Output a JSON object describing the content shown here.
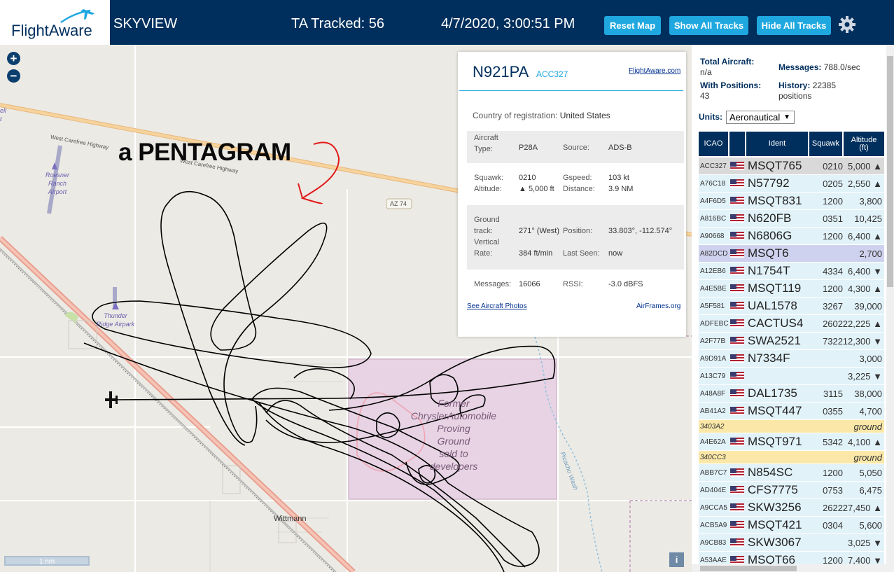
{
  "header": {
    "logo_text": "FlightAware",
    "app_title": "SKYVIEW",
    "tracked": "TA Tracked: 56",
    "datetime": "4/7/2020, 3:00:51 PM",
    "reset_map": "Reset Map",
    "show_tracks": "Show All Tracks",
    "hide_tracks": "Hide All Tracks",
    "settings_icon": "gear-icon"
  },
  "map": {
    "zoom_in": "+",
    "zoom_out": "−",
    "annotation": "a PENTAGRAM",
    "highway_name_1": "West Carefree Highway",
    "highway_name_2": "West Carefree Highway",
    "route_shield": "AZ 74",
    "airport_1": [
      "Roesner",
      "Ranch",
      "Airport"
    ],
    "airport_2": [
      "Thunder",
      "Ridge Airpark"
    ],
    "area_label": [
      "Former",
      "ChryslerAutomobile",
      "Proving",
      "Ground",
      "sold to",
      "developers"
    ],
    "town": "Wittmann",
    "wash": "Picacho Wash",
    "edge_label": [
      "ell",
      "t"
    ],
    "scale": "1 nm",
    "info": "i"
  },
  "popup": {
    "registration": "N921PA",
    "icao": "ACC327",
    "fa_link": "FlightAware.com",
    "country_label": "Country of registration:",
    "country": "United States",
    "aircraft_type_label": "Aircraft Type:",
    "aircraft_type": "P28A",
    "source_label": "Source:",
    "source": "ADS-B",
    "squawk_label": "Squawk:",
    "squawk": "0210",
    "gspeed_label": "Gspeed:",
    "gspeed": "103 kt",
    "altitude_label": "Altitude:",
    "altitude": "▲ 5,000 ft",
    "distance_label": "Distance:",
    "distance": "3.9 NM",
    "track_label_1": "Ground",
    "track_label_2": "track:",
    "track": "271° (West)",
    "position_label": "Position:",
    "position": "33.803°, -112.574°",
    "vrate_label_1": "Vertical",
    "vrate_label_2": "Rate:",
    "vrate": "384 ft/min",
    "last_seen_label": "Last Seen:",
    "last_seen": "now",
    "messages_label": "Messages:",
    "messages": "16066",
    "rssi_label": "RSSI:",
    "rssi": "-3.0 dBFS",
    "photos_link": "See Aircraft Photos",
    "airframes_link": "AirFrames.org"
  },
  "panel": {
    "total_label": "Total Aircraft:",
    "total_value": "n/a",
    "messages_label": "Messages:",
    "messages_value": "788.0/sec",
    "positions_label": "With Positions:",
    "positions_value": "43",
    "history_label": "History:",
    "history_value": "22385",
    "history_unit": "positions",
    "units_label": "Units:",
    "units_value": "Aeronautical",
    "columns": [
      "ICAO",
      "Ident",
      "Squawk",
      "Altitude (ft)"
    ],
    "rows": [
      {
        "icao": "ACC327",
        "ident": "MSQT765",
        "squawk": "0210",
        "alt": "5,000 ▲",
        "style": "selected",
        "flag": true
      },
      {
        "icao": "A76C18",
        "ident": "N57792",
        "squawk": "0205",
        "alt": "2,550 ▲",
        "style": "normal",
        "flag": true
      },
      {
        "icao": "A4F6D5",
        "ident": "MSQT831",
        "squawk": "1200",
        "alt": "3,800",
        "style": "normal",
        "flag": true
      },
      {
        "icao": "A816BC",
        "ident": "N620FB",
        "squawk": "0351",
        "alt": "10,425",
        "style": "normal",
        "flag": true
      },
      {
        "icao": "A90668",
        "ident": "N6806G",
        "squawk": "1200",
        "alt": "6,400 ▲",
        "style": "normal",
        "flag": true
      },
      {
        "icao": "A82DCD",
        "ident": "MSQT6",
        "squawk": "",
        "alt": "2,700",
        "style": "hover",
        "flag": true
      },
      {
        "icao": "A12EB6",
        "ident": "N1754T",
        "squawk": "4334",
        "alt": "6,400 ▼",
        "style": "normal",
        "flag": true
      },
      {
        "icao": "A4E5BE",
        "ident": "MSQT119",
        "squawk": "1200",
        "alt": "4,300 ▲",
        "style": "normal",
        "flag": true
      },
      {
        "icao": "A5F581",
        "ident": "UAL1578",
        "squawk": "3267",
        "alt": "39,000",
        "style": "normal",
        "flag": true
      },
      {
        "icao": "ADFEBC",
        "ident": "CACTUS4",
        "squawk": "2602",
        "alt": "22,225 ▲",
        "style": "normal",
        "flag": true
      },
      {
        "icao": "A2F77B",
        "ident": "SWA2521",
        "squawk": "7322",
        "alt": "12,300 ▼",
        "style": "normal",
        "flag": true
      },
      {
        "icao": "A9D91A",
        "ident": "N7334F",
        "squawk": "",
        "alt": "3,000",
        "style": "normal",
        "flag": true
      },
      {
        "icao": "A13C79",
        "ident": "",
        "squawk": "",
        "alt": "3,225 ▼",
        "style": "normal",
        "flag": true
      },
      {
        "icao": "A48A8F",
        "ident": "DAL1735",
        "squawk": "3115",
        "alt": "38,000",
        "style": "normal",
        "flag": true
      },
      {
        "icao": "AB41A2",
        "ident": "MSQT447",
        "squawk": "0355",
        "alt": "4,700",
        "style": "normal",
        "flag": true
      },
      {
        "icao": "3403A2",
        "ident": "",
        "squawk": "",
        "alt": "ground",
        "style": "ground",
        "flag": false
      },
      {
        "icao": "A4E62A",
        "ident": "MSQT971",
        "squawk": "5342",
        "alt": "4,100 ▲",
        "style": "normal",
        "flag": true
      },
      {
        "icao": "340CC3",
        "ident": "",
        "squawk": "",
        "alt": "ground",
        "style": "ground",
        "flag": false
      },
      {
        "icao": "ABB7C7",
        "ident": "N854SC",
        "squawk": "1200",
        "alt": "5,050",
        "style": "normal",
        "flag": true
      },
      {
        "icao": "AD404E",
        "ident": "CFS7775",
        "squawk": "0753",
        "alt": "6,475",
        "style": "normal",
        "flag": true
      },
      {
        "icao": "A9CCA5",
        "ident": "SKW3256",
        "squawk": "2622",
        "alt": "27,450 ▲",
        "style": "normal",
        "flag": true
      },
      {
        "icao": "ACB5A9",
        "ident": "MSQT421",
        "squawk": "0304",
        "alt": "5,600",
        "style": "normal",
        "flag": true
      },
      {
        "icao": "A9CB83",
        "ident": "SKW3067",
        "squawk": "",
        "alt": "3,025 ▼",
        "style": "normal",
        "flag": true
      },
      {
        "icao": "A53AAE",
        "ident": "MSQT66",
        "squawk": "1200",
        "alt": "7,400 ▼",
        "style": "normal",
        "flag": true
      }
    ]
  },
  "colors": {
    "header_bg": "#002f5d",
    "accent": "#1fa8e0",
    "row_normal": "#e2f2f9",
    "row_selected": "#d9d9d9",
    "row_hover": "#cfd2ee",
    "row_ground": "#fbe8a8",
    "track": "#000000",
    "annotation_arrow": "#e01a1a"
  }
}
